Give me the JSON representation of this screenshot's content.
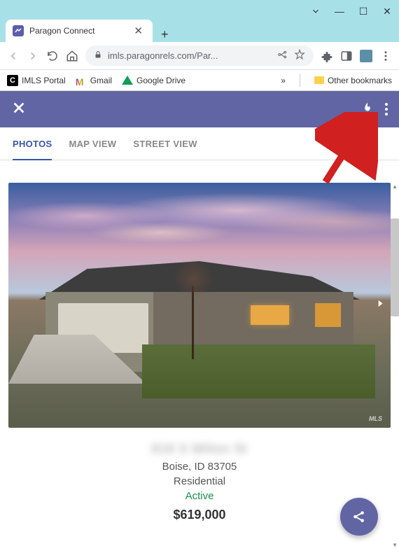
{
  "window": {
    "tab_title": "Paragon Connect",
    "url_display": "imls.paragonrels.com/Par..."
  },
  "bookmarks": {
    "imls": "IMLS Portal",
    "gmail": "Gmail",
    "drive": "Google Drive",
    "overflow": "»",
    "other": "Other bookmarks"
  },
  "tabs": {
    "photos": "PHOTOS",
    "map": "MAP VIEW",
    "street": "STREET VIEW"
  },
  "property": {
    "address_blurred": "818 S Milton St",
    "city_state_zip": "Boise, ID 83705",
    "type": "Residential",
    "status": "Active",
    "price": "$619,000"
  },
  "photo": {
    "watermark": "MLS"
  }
}
